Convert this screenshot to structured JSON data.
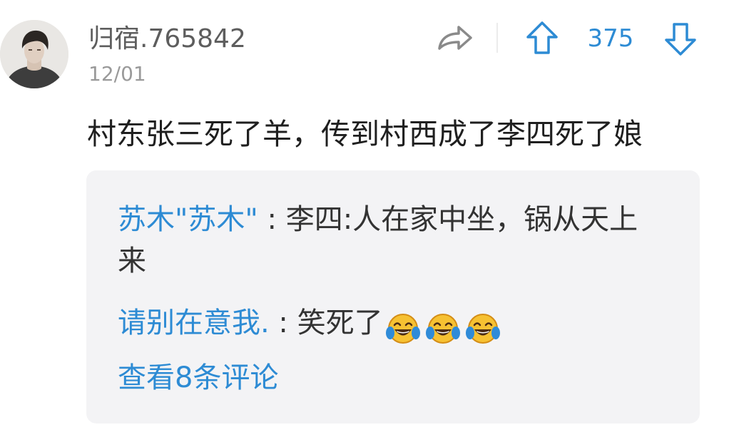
{
  "comment": {
    "username": "归宿.765842",
    "date": "12/01",
    "text": "村东张三死了羊，传到村西成了李四死了娘",
    "vote_count": "375",
    "icons": {
      "avatar": "avatar",
      "share": "share-icon",
      "up": "up-arrow-icon",
      "down": "down-arrow-icon"
    },
    "colors": {
      "accent": "#2d8bd4",
      "text": "#1f1f1f",
      "meta": "#9a9a9a",
      "reply_bg": "#f3f3f5"
    }
  },
  "replies": [
    {
      "user": "苏木\"苏木\"",
      "separator": " : ",
      "text": "李四:人在家中坐，锅从天上来"
    },
    {
      "user": "请别在意我.",
      "separator": " : ",
      "text": "笑死了",
      "emojis": [
        "laughing-tears-emoji",
        "laughing-tears-emoji",
        "laughing-tears-emoji"
      ]
    }
  ],
  "view_more": "查看8条评论"
}
